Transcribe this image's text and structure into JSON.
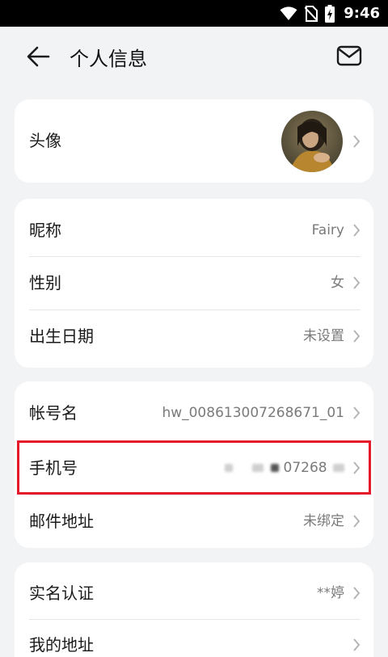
{
  "status_bar": {
    "time": "9:46",
    "icons": [
      "wifi-icon",
      "no-sim-icon",
      "battery-charging-icon"
    ]
  },
  "header": {
    "title": "个人信息",
    "back_icon": "arrow-left-icon",
    "mail_icon": "mail-icon"
  },
  "profile": {
    "avatar_label": "头像",
    "basic": [
      {
        "label": "昵称",
        "value": "Fairy"
      },
      {
        "label": "性别",
        "value": "女"
      },
      {
        "label": "出生日期",
        "value": "未设置"
      }
    ],
    "account": [
      {
        "label": "帐号名",
        "value": "hw_008613007268671_01"
      },
      {
        "label": "手机号",
        "value": "07268"
      },
      {
        "label": "邮件地址",
        "value": "未绑定"
      }
    ],
    "more": [
      {
        "label": "实名认证",
        "value": "**婷"
      },
      {
        "label": "我的地址",
        "value": ""
      }
    ]
  },
  "colors": {
    "background": "#f1f3f5",
    "card": "#ffffff",
    "highlight": "#e5192a",
    "value_text": "#7a7a7a"
  }
}
